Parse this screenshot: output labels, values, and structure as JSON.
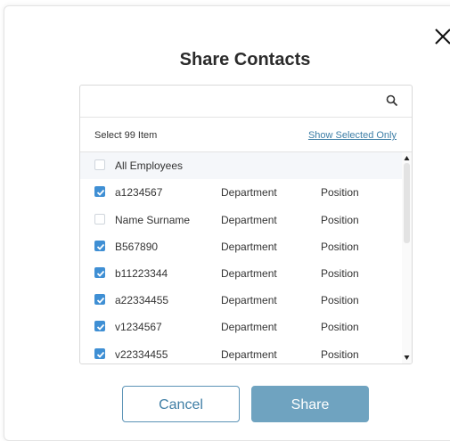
{
  "modal": {
    "title": "Share Contacts",
    "close_icon": "close-icon"
  },
  "search": {
    "value": "",
    "placeholder": "",
    "icon": "search-icon"
  },
  "selection": {
    "count_text": "Select 99 Item",
    "show_selected_label": "Show Selected Only"
  },
  "list": {
    "all_employees": {
      "label": "All Employees",
      "checked": false
    },
    "rows": [
      {
        "name": "a1234567",
        "department": "Department",
        "position": "Position",
        "checked": true
      },
      {
        "name": "Name Surname",
        "department": "Department",
        "position": "Position",
        "checked": false
      },
      {
        "name": "B567890",
        "department": "Department",
        "position": "Position",
        "checked": true
      },
      {
        "name": "b11223344",
        "department": "Department",
        "position": "Position",
        "checked": true
      },
      {
        "name": "a22334455",
        "department": "Department",
        "position": "Position",
        "checked": true
      },
      {
        "name": "v1234567",
        "department": "Department",
        "position": "Position",
        "checked": true
      },
      {
        "name": "v22334455",
        "department": "Department",
        "position": "Position",
        "checked": true
      }
    ]
  },
  "buttons": {
    "cancel_label": "Cancel",
    "share_label": "Share"
  },
  "colors": {
    "accent": "#3f8fd4",
    "primary_button": "#6fa3c0",
    "link": "#3d7ea6"
  }
}
